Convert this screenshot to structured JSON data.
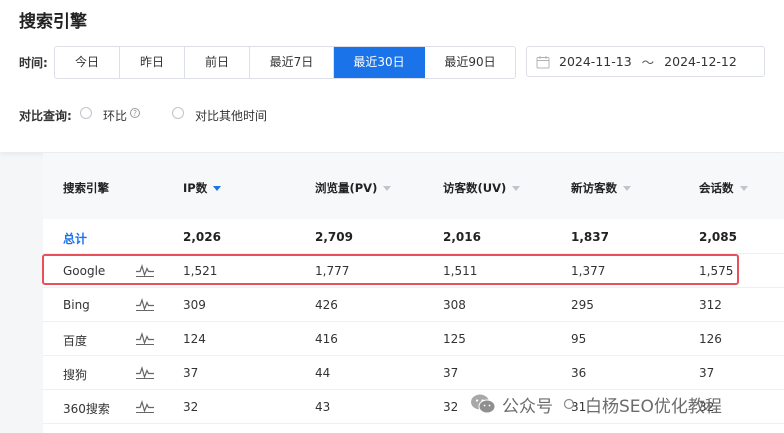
{
  "page_title": "搜索引擎",
  "filters": {
    "time_label": "时间:",
    "tabs": [
      {
        "label": "今日",
        "active": false
      },
      {
        "label": "昨日",
        "active": false
      },
      {
        "label": "前日",
        "active": false
      },
      {
        "label": "最近7日",
        "active": false
      },
      {
        "label": "最近30日",
        "active": true
      },
      {
        "label": "最近90日",
        "active": false
      }
    ],
    "date_start": "2024-11-13",
    "date_separator": "～",
    "date_end": "2024-12-12",
    "compare_label": "对比查询:",
    "compare_options": [
      "环比",
      "对比其他时间"
    ]
  },
  "table": {
    "columns": [
      {
        "label": "搜索引擎",
        "sortable": false,
        "sorted": false
      },
      {
        "label": "IP数",
        "sortable": true,
        "sorted": true
      },
      {
        "label": "浏览量(PV)",
        "sortable": true,
        "sorted": false
      },
      {
        "label": "访客数(UV)",
        "sortable": true,
        "sorted": false
      },
      {
        "label": "新访客数",
        "sortable": true,
        "sorted": false
      },
      {
        "label": "会话数",
        "sortable": true,
        "sorted": false
      }
    ],
    "total": {
      "name": "总计",
      "values": [
        "2,026",
        "2,709",
        "2,016",
        "1,837",
        "2,085"
      ]
    },
    "rows": [
      {
        "name": "Google",
        "values": [
          "1,521",
          "1,777",
          "1,511",
          "1,377",
          "1,575"
        ],
        "highlighted": true
      },
      {
        "name": "Bing",
        "values": [
          "309",
          "426",
          "308",
          "295",
          "312"
        ],
        "highlighted": false
      },
      {
        "name": "百度",
        "values": [
          "124",
          "416",
          "125",
          "95",
          "126"
        ],
        "highlighted": false
      },
      {
        "name": "搜狗",
        "values": [
          "37",
          "44",
          "37",
          "36",
          "37"
        ],
        "highlighted": false
      },
      {
        "name": "360搜索",
        "values": [
          "32",
          "43",
          "32",
          "31",
          "32"
        ],
        "highlighted": false
      }
    ]
  },
  "watermark": {
    "account": "公众号",
    "name": "白杨SEO优化教程"
  },
  "colors": {
    "accent": "#1a73e8",
    "highlight_border": "#e8505b"
  }
}
